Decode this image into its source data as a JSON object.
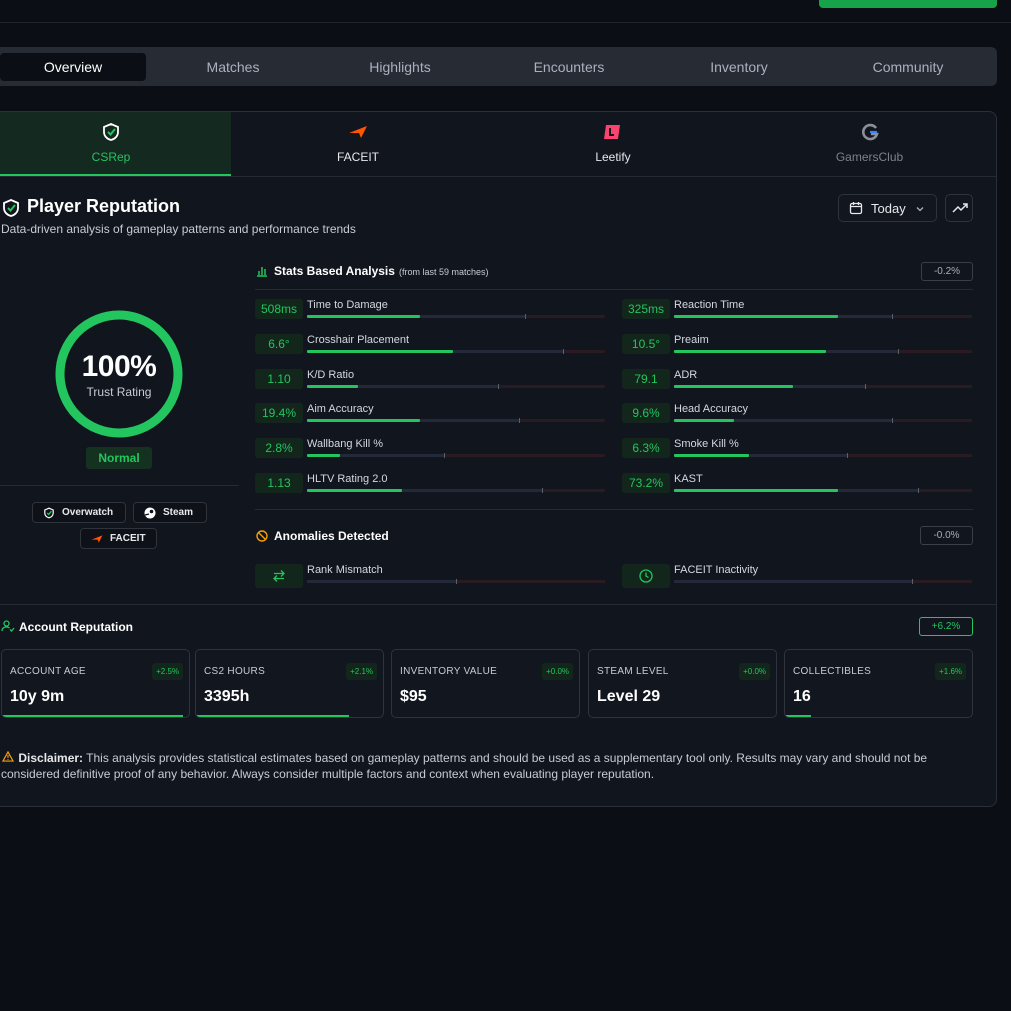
{
  "nav": {
    "tabs": [
      {
        "label": "Overview",
        "active": true
      },
      {
        "label": "Matches",
        "active": false
      },
      {
        "label": "Highlights",
        "active": false
      },
      {
        "label": "Encounters",
        "active": false
      },
      {
        "label": "Inventory",
        "active": false
      },
      {
        "label": "Community",
        "active": false
      }
    ]
  },
  "providers": [
    {
      "label": "CSRep",
      "icon": "shield-check-icon",
      "active": true,
      "color": "#22c55e"
    },
    {
      "label": "FACEIT",
      "icon": "faceit-icon",
      "active": false,
      "color": "#ff5500"
    },
    {
      "label": "Leetify",
      "icon": "leetify-icon",
      "active": false,
      "color": "#f8446f"
    },
    {
      "label": "GamersClub",
      "icon": "gamersclub-icon",
      "active": false,
      "color": "#6b7280"
    }
  ],
  "header": {
    "title": "Player Reputation",
    "subtitle": "Data-driven analysis of gameplay patterns and performance trends",
    "period": "Today"
  },
  "trust": {
    "percent": "100%",
    "label": "Trust Rating",
    "status": "Normal",
    "level": 1.0,
    "badges": [
      "Overwatch",
      "Steam",
      "FACEIT"
    ]
  },
  "stats": {
    "title": "Stats Based Analysis",
    "subtitle": "(from last 59 matches)",
    "delta": "-0.2%",
    "metrics": [
      {
        "value": "508ms",
        "name": "Time to Damage",
        "fill": 0.38,
        "mid": 0.73
      },
      {
        "value": "325ms",
        "name": "Reaction Time",
        "fill": 0.55,
        "mid": 0.73
      },
      {
        "value": "6.6°",
        "name": "Crosshair Placement",
        "fill": 0.49,
        "mid": 0.86
      },
      {
        "value": "10.5°",
        "name": "Preaim",
        "fill": 0.51,
        "mid": 0.75
      },
      {
        "value": "1.10",
        "name": "K/D Ratio",
        "fill": 0.17,
        "mid": 0.64
      },
      {
        "value": "79.1",
        "name": "ADR",
        "fill": 0.4,
        "mid": 0.64
      },
      {
        "value": "19.4%",
        "name": "Aim Accuracy",
        "fill": 0.38,
        "mid": 0.71
      },
      {
        "value": "9.6%",
        "name": "Head Accuracy",
        "fill": 0.2,
        "mid": 0.73
      },
      {
        "value": "2.8%",
        "name": "Wallbang Kill %",
        "fill": 0.11,
        "mid": 0.46
      },
      {
        "value": "6.3%",
        "name": "Smoke Kill %",
        "fill": 0.25,
        "mid": 0.58
      },
      {
        "value": "1.13",
        "name": "HLTV Rating 2.0",
        "fill": 0.32,
        "mid": 0.79
      },
      {
        "value": "73.2%",
        "name": "KAST",
        "fill": 0.55,
        "mid": 0.82
      }
    ]
  },
  "anomalies": {
    "title": "Anomalies Detected",
    "delta": "-0.0%",
    "items": [
      {
        "name": "Rank Mismatch",
        "icon": "swap-icon",
        "mid": 0.5
      },
      {
        "name": "FACEIT Inactivity",
        "icon": "clock-icon",
        "mid": 0.8
      }
    ]
  },
  "account": {
    "title": "Account Reputation",
    "delta": "+6.2%",
    "cards": [
      {
        "label": "ACCOUNT AGE",
        "value": "10y 9m",
        "delta": "+2.5%",
        "level": 0.97
      },
      {
        "label": "CS2 HOURS",
        "value": "3395h",
        "delta": "+2.1%",
        "level": 0.82
      },
      {
        "label": "INVENTORY VALUE",
        "value": "$95",
        "delta": "+0.0%",
        "level": 0.0
      },
      {
        "label": "STEAM LEVEL",
        "value": "Level 29",
        "delta": "+0.0%",
        "level": 0.0
      },
      {
        "label": "COLLECTIBLES",
        "value": "16",
        "delta": "+1.6%",
        "level": 0.14
      }
    ]
  },
  "disclaimer": {
    "label": "Disclaimer:",
    "text": "This analysis provides statistical estimates based on gameplay patterns and should be used as a supplementary tool only. Results may vary and should not be considered definitive proof of any behavior. Always consider multiple factors and context when evaluating player reputation."
  },
  "colors": {
    "accent": "#22c55e",
    "background": "#0b0e14",
    "panel": "#11151d",
    "warning": "#f59e0b"
  }
}
